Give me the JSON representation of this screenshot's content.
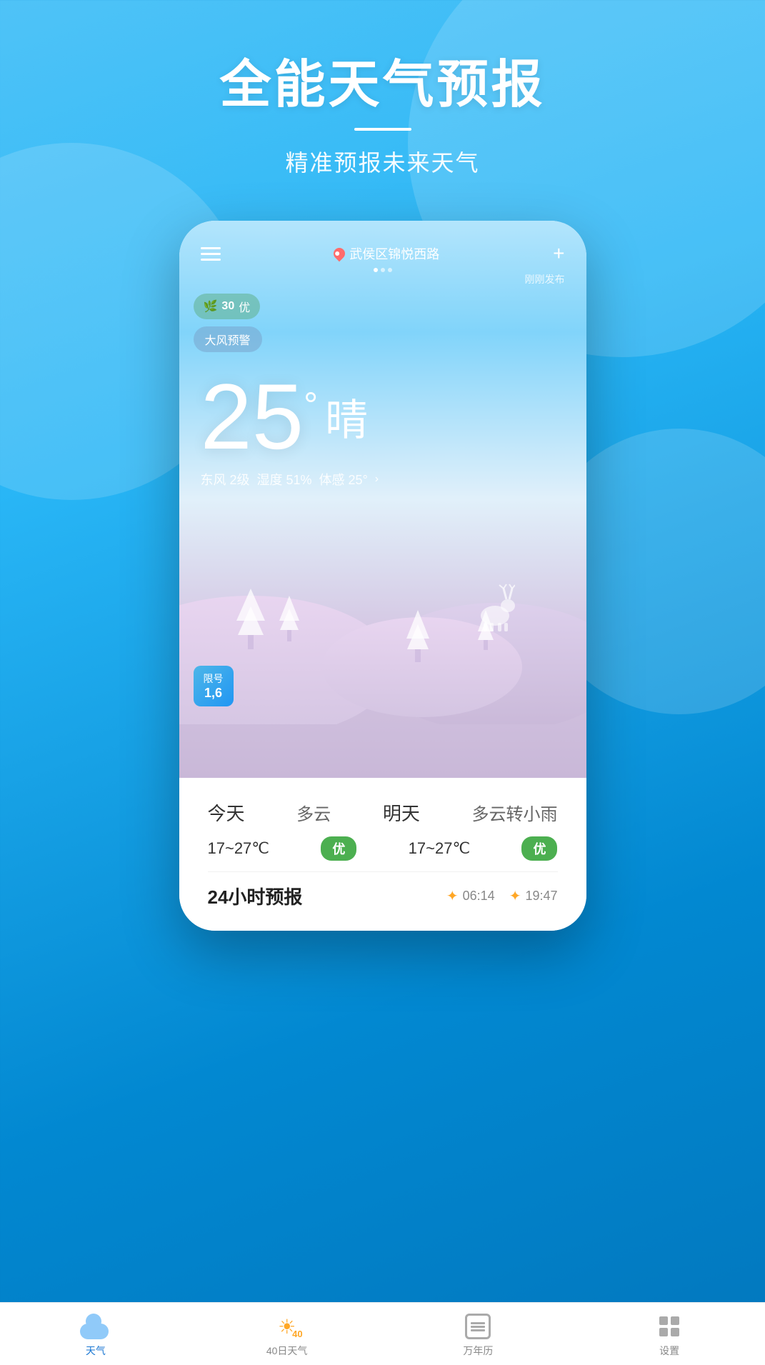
{
  "app": {
    "title": "全能天气预报",
    "subtitle": "精准预报未来天气"
  },
  "phone": {
    "location": "武侯区锦悦西路",
    "published_time": "刚刚发布",
    "aqi": {
      "value": "30",
      "label": "优"
    },
    "warning": "大风预警",
    "temperature": "25",
    "condition": "晴",
    "wind": "东风 2级",
    "humidity": "湿度 51%",
    "feels_like": "体感 25°",
    "plate_restriction": {
      "label": "限号",
      "numbers": "1,6"
    }
  },
  "forecast": {
    "today": {
      "day": "今天",
      "condition": "多云",
      "temp": "17~27℃",
      "quality": "优"
    },
    "tomorrow": {
      "day": "明天",
      "condition": "多云转小雨",
      "temp": "17~27℃",
      "quality": "优"
    }
  },
  "forecast_24h": {
    "title": "24小时预报",
    "sunrise": "06:14",
    "sunset": "19:47"
  },
  "nav": {
    "items": [
      {
        "label": "天气",
        "icon": "cloud",
        "active": true
      },
      {
        "label": "40日天气",
        "icon": "sun40",
        "active": false
      },
      {
        "label": "万年历",
        "icon": "calendar",
        "active": false
      },
      {
        "label": "设置",
        "icon": "settings",
        "active": false
      }
    ]
  }
}
